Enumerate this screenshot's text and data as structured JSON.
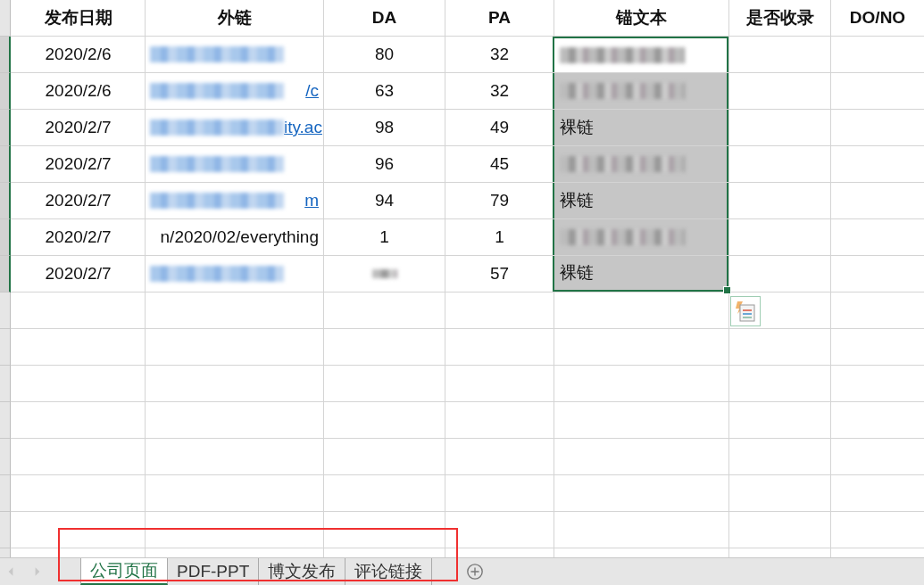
{
  "columns": [
    "发布日期",
    "外链",
    "DA",
    "PA",
    "锚文本",
    "是否收录",
    "DO/NO"
  ],
  "rows": [
    {
      "date": "2020/2/6",
      "link": {
        "kind": "link",
        "redacted": true
      },
      "da": {
        "text": "80"
      },
      "pa": "32",
      "anchor": {
        "redacted": true,
        "selected": true,
        "active": true
      }
    },
    {
      "date": "2020/2/6",
      "link": {
        "kind": "link",
        "text": "/c",
        "redacted": true
      },
      "da": {
        "text": "63"
      },
      "pa": "32",
      "anchor": {
        "redacted": true,
        "selected": true,
        "active": false
      }
    },
    {
      "date": "2020/2/7",
      "link": {
        "kind": "link",
        "text": "ity.ac",
        "redacted": true
      },
      "da": {
        "text": "98"
      },
      "pa": "49",
      "anchor": {
        "text": "裸链",
        "selected": true,
        "active": false
      }
    },
    {
      "date": "2020/2/7",
      "link": {
        "kind": "link",
        "redacted": true
      },
      "da": {
        "text": "96"
      },
      "pa": "45",
      "anchor": {
        "redacted": true,
        "selected": true,
        "active": false
      }
    },
    {
      "date": "2020/2/7",
      "link": {
        "kind": "link",
        "text": "m",
        "redacted": true
      },
      "da": {
        "text": "94"
      },
      "pa": "79",
      "anchor": {
        "text": "裸链",
        "selected": true,
        "active": false
      }
    },
    {
      "date": "2020/2/7",
      "link": {
        "kind": "plain",
        "text": "n/2020/02/everything"
      },
      "da": {
        "text": "1"
      },
      "pa": "1",
      "anchor": {
        "redacted": true,
        "selected": true,
        "active": false
      }
    },
    {
      "date": "2020/2/7",
      "link": {
        "kind": "link",
        "redacted": true
      },
      "da": {
        "redacted": true
      },
      "pa": "57",
      "anchor": {
        "text": "裸链",
        "selected": true,
        "active": false
      }
    }
  ],
  "sheet_tabs": [
    {
      "label": "公司页面",
      "selected": true
    },
    {
      "label": "PDF-PPT",
      "selected": false
    },
    {
      "label": "博文发布",
      "selected": false
    },
    {
      "label": "评论链接",
      "selected": false
    }
  ]
}
